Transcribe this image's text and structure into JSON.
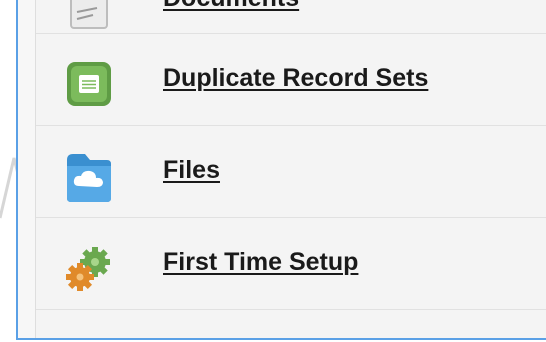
{
  "list": {
    "items": [
      {
        "label": "Documents",
        "icon": "document-icon"
      },
      {
        "label": "Duplicate Record Sets",
        "icon": "duplicate-record-sets-icon"
      },
      {
        "label": "Files",
        "icon": "files-cloud-folder-icon"
      },
      {
        "label": "First Time Setup",
        "icon": "gears-setup-icon"
      }
    ]
  },
  "colors": {
    "panel_border": "#5aa0e6",
    "link_text": "#1a1a1a",
    "duplicate_icon_green": "#6aa84f",
    "files_icon_blue": "#3a9ad9",
    "setup_icon_orange": "#e08a2a",
    "setup_icon_green": "#6aa84f"
  }
}
